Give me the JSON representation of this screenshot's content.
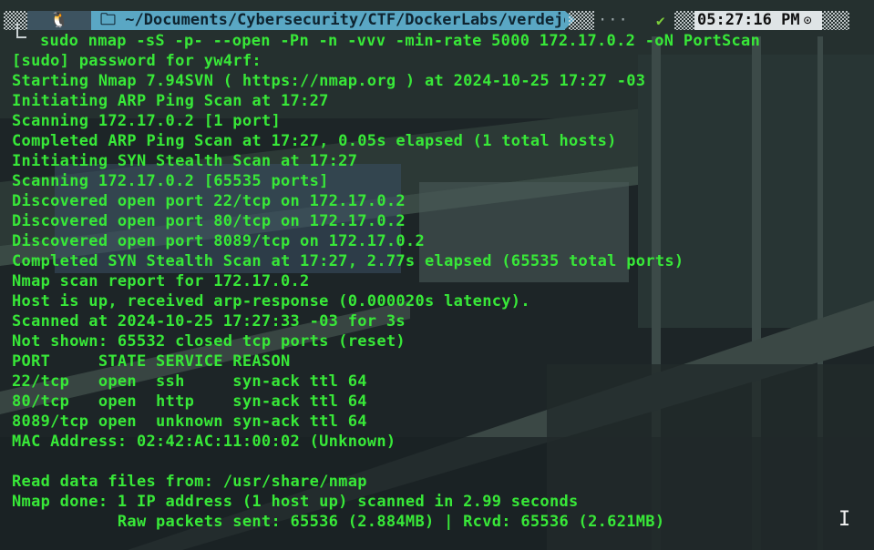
{
  "prompt": {
    "os_icon": "linux-tux-icon",
    "folder_icon": "folder-icon",
    "path": "~/Documents/Cybersecurity/CTF/DockerLabs/verdejo",
    "dots": "···",
    "status_check": "✔",
    "time": "05:27:16 PM",
    "clock_icon": "clock-icon"
  },
  "command": "sudo nmap -sS -p- --open -Pn -n -vvv -min-rate 5000 172.17.0.2 -oN PortScan",
  "output": [
    "[sudo] password for yw4rf:",
    "Starting Nmap 7.94SVN ( https://nmap.org ) at 2024-10-25 17:27 -03",
    "Initiating ARP Ping Scan at 17:27",
    "Scanning 172.17.0.2 [1 port]",
    "Completed ARP Ping Scan at 17:27, 0.05s elapsed (1 total hosts)",
    "Initiating SYN Stealth Scan at 17:27",
    "Scanning 172.17.0.2 [65535 ports]",
    "Discovered open port 22/tcp on 172.17.0.2",
    "Discovered open port 80/tcp on 172.17.0.2",
    "Discovered open port 8089/tcp on 172.17.0.2",
    "Completed SYN Stealth Scan at 17:27, 2.77s elapsed (65535 total ports)",
    "Nmap scan report for 172.17.0.2",
    "Host is up, received arp-response (0.000020s latency).",
    "Scanned at 2024-10-25 17:27:33 -03 for 3s",
    "Not shown: 65532 closed tcp ports (reset)",
    "PORT     STATE SERVICE REASON",
    "22/tcp   open  ssh     syn-ack ttl 64",
    "80/tcp   open  http    syn-ack ttl 64",
    "8089/tcp open  unknown syn-ack ttl 64",
    "MAC Address: 02:42:AC:11:00:02 (Unknown)",
    "",
    "Read data files from: /usr/share/nmap",
    "Nmap done: 1 IP address (1 host up) scanned in 2.99 seconds",
    "           Raw packets sent: 65536 (2.884MB) | Rcvd: 65536 (2.621MB)"
  ],
  "colors": {
    "text": "#38e838",
    "path_segment": "#5aa7c4",
    "time_segment": "#dfe4e6",
    "background": "#1b2325"
  }
}
